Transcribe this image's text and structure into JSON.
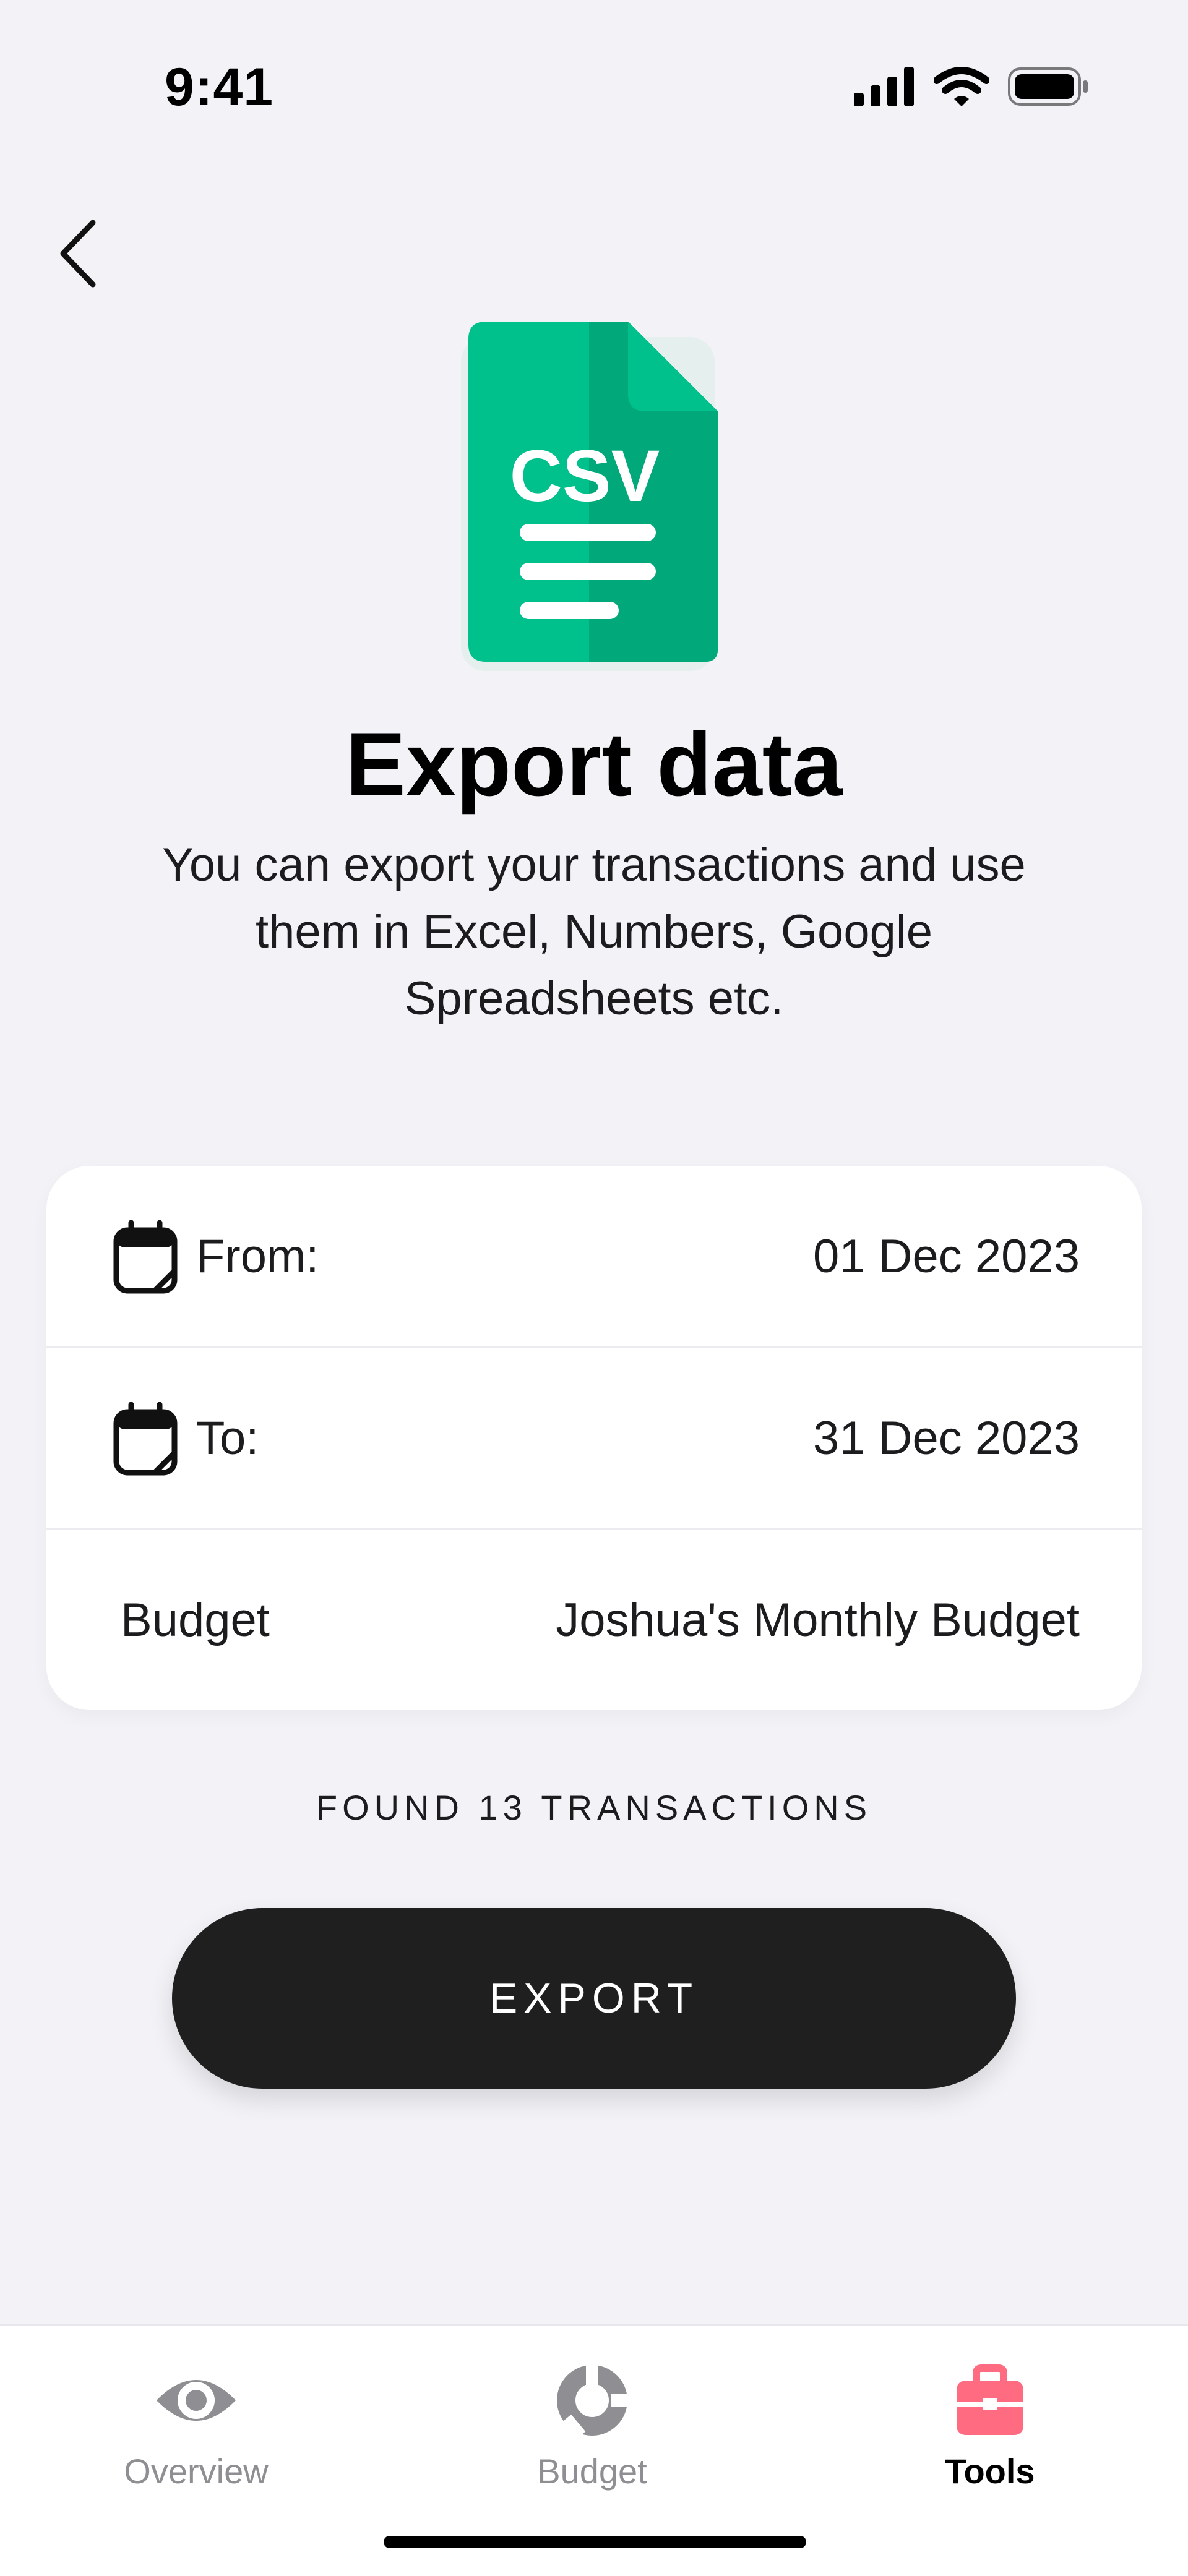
{
  "status_bar": {
    "time": "9:41",
    "icons": [
      "cellular-signal-icon",
      "wifi-icon",
      "battery-icon"
    ]
  },
  "header": {
    "back_icon": "chevron-left-icon"
  },
  "hero": {
    "icon": "csv-file-icon",
    "icon_text": "CSV",
    "icon_colors": {
      "light": "#00c08b",
      "dark": "#00a87a"
    },
    "title": "Export data",
    "description": "You can export your transactions and use them in Excel, Numbers, Google Spreadsheets etc."
  },
  "form": {
    "rows": [
      {
        "icon": "calendar-icon",
        "label": "From:",
        "value": "01 Dec 2023"
      },
      {
        "icon": "calendar-icon",
        "label": "To:",
        "value": "31 Dec 2023"
      },
      {
        "label": "Budget",
        "value": "Joshua's Monthly Budget"
      }
    ]
  },
  "summary": {
    "found_text": "FOUND 13 TRANSACTIONS"
  },
  "actions": {
    "export_label": "EXPORT"
  },
  "tab_bar": {
    "active_color": "#ff6b81",
    "items": [
      {
        "icon": "eye-icon",
        "label": "Overview",
        "active": false
      },
      {
        "icon": "donut-chart-icon",
        "label": "Budget",
        "active": false
      },
      {
        "icon": "toolbox-icon",
        "label": "Tools",
        "active": true
      }
    ]
  }
}
